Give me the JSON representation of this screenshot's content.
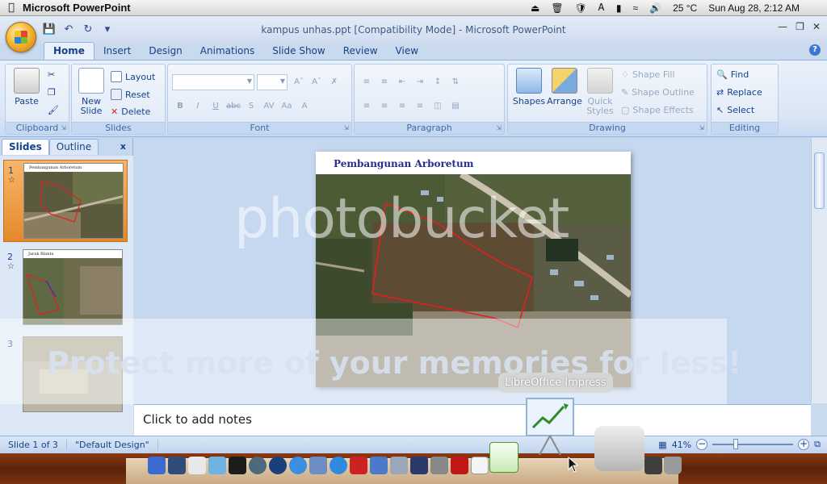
{
  "system_bar": {
    "app_name": "Microsoft PowerPoint",
    "weather": "25 °C",
    "datetime": "Sun Aug 28,  2:12 AM"
  },
  "window": {
    "title": "kampus unhas.ppt [Compatibility Mode] - Microsoft PowerPoint"
  },
  "ribbon": {
    "tabs": [
      "Home",
      "Insert",
      "Design",
      "Animations",
      "Slide Show",
      "Review",
      "View"
    ],
    "active_tab": "Home",
    "clipboard": {
      "paste": "Paste",
      "label": "Clipboard"
    },
    "slides": {
      "new_slide_1": "New",
      "new_slide_2": "Slide",
      "layout": "Layout",
      "reset": "Reset",
      "delete": "Delete",
      "label": "Slides"
    },
    "font": {
      "label": "Font"
    },
    "paragraph": {
      "label": "Paragraph"
    },
    "drawing": {
      "shapes": "Shapes",
      "arrange": "Arrange",
      "quick_styles_1": "Quick",
      "quick_styles_2": "Styles",
      "shape_fill": "Shape Fill",
      "shape_outline": "Shape Outline",
      "shape_effects": "Shape Effects",
      "label": "Drawing"
    },
    "editing": {
      "find": "Find",
      "replace": "Replace",
      "select": "Select",
      "label": "Editing"
    }
  },
  "left_panel": {
    "tabs": [
      "Slides",
      "Outline"
    ],
    "close": "x",
    "thumbnails": [
      {
        "number": "1",
        "title": "Pembangunan Arboretum"
      },
      {
        "number": "2",
        "title": "Jarak Blanta"
      },
      {
        "number": "3",
        "title": ""
      }
    ]
  },
  "slide": {
    "title": "Pembangunan Arboretum"
  },
  "notes": {
    "placeholder": "Click to add notes"
  },
  "status_bar": {
    "slide_counter": "Slide 1 of 3",
    "theme": "\"Default Design\"",
    "zoom": "41%"
  },
  "watermark": {
    "brand": "photobucket",
    "tagline": "Protect more of your memories for less!"
  },
  "tooltip": {
    "text": "LibreOffice Impress"
  }
}
